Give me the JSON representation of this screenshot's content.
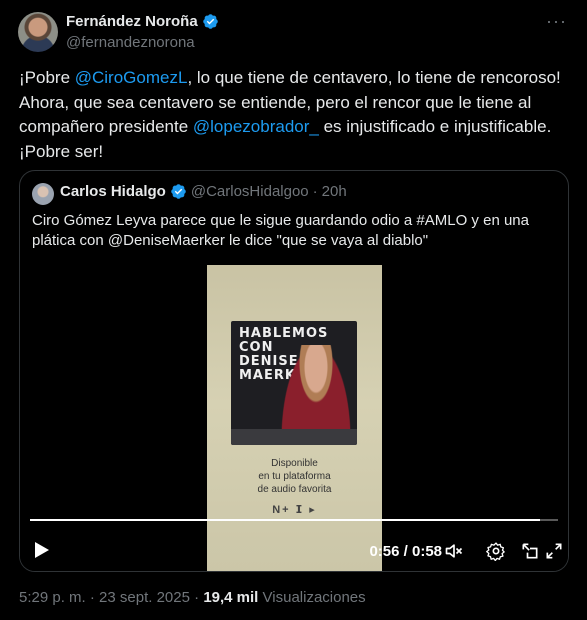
{
  "author": {
    "name": "Fernández Noroña",
    "handle": "@fernandeznorona"
  },
  "tweet": {
    "part1": "¡Pobre ",
    "mention1": "@CiroGomezL",
    "part2": ", lo que tiene de centavero, lo tiene de rencoroso! Ahora, que sea centavero se entiende, pero el rencor que le tiene al compañero presidente ",
    "mention2": "@lopezobrador_",
    "part3": " es injustificado e injustificable. ¡Pobre ser!"
  },
  "quoted": {
    "name": "Carlos Hidalgo",
    "handle": "@CarlosHidalgoo",
    "separator": "·",
    "time": "20h",
    "text": "Ciro Gómez Leyva parece que le sigue guardando odio a #AMLO y en una plática con @DeniseMaerker le dice \"que se vaya al diablo\"",
    "video": {
      "cover_title": "HABLEMOS\nCON\nDENISE\nMAERKER",
      "available_text": "Disponible\nen tu plataforma\nde audio favorita",
      "logos_text": "N+  ⵊ ▸",
      "time_display": "0:56 / 0:58",
      "progress": 0.965
    }
  },
  "footer": {
    "time": "5:29 p. m.",
    "separator": "·",
    "date": "23 sept. 2025",
    "separator2": "·",
    "views_count": "19,4 mil",
    "views_label": "Visualizaciones"
  },
  "icons": {
    "verified": "verified-badge-icon",
    "more": "more-icon",
    "play": "play-icon",
    "volume": "volume-icon",
    "settings": "gear-icon",
    "popout": "popout-icon",
    "fullscreen": "fullscreen-icon"
  },
  "colors": {
    "background": "#000000",
    "accent": "#1d9bf0",
    "muted": "#71767b",
    "text": "#e7e9ea"
  }
}
